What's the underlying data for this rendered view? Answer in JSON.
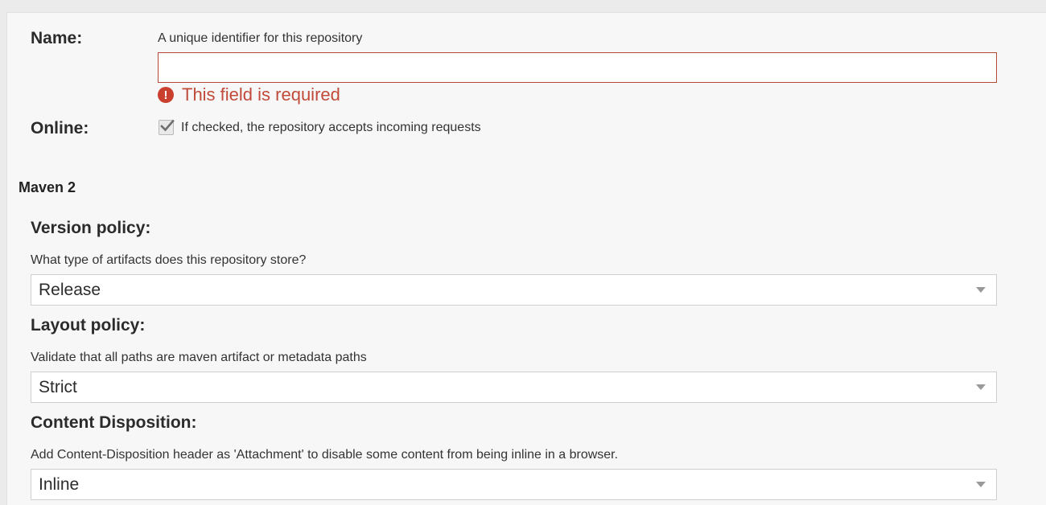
{
  "name_field": {
    "label": "Name:",
    "help": "A unique identifier for this repository",
    "value": "",
    "error": "This field is required",
    "error_icon": "exclamation-circle-icon"
  },
  "online_field": {
    "label": "Online:",
    "checked": true,
    "help": "If checked, the repository accepts incoming requests"
  },
  "section": {
    "title": "Maven 2"
  },
  "version_policy": {
    "label": "Version policy:",
    "help": "What type of artifacts does this repository store?",
    "selected": "Release"
  },
  "layout_policy": {
    "label": "Layout policy:",
    "help": "Validate that all paths are maven artifact or metadata paths",
    "selected": "Strict"
  },
  "content_disposition": {
    "label": "Content Disposition:",
    "help": "Add Content-Disposition header as 'Attachment' to disable some content from being inline in a browser.",
    "selected": "Inline"
  },
  "colors": {
    "error": "#c14a3b",
    "panel_bg": "#f7f7f7",
    "page_bg": "#ebebeb"
  }
}
